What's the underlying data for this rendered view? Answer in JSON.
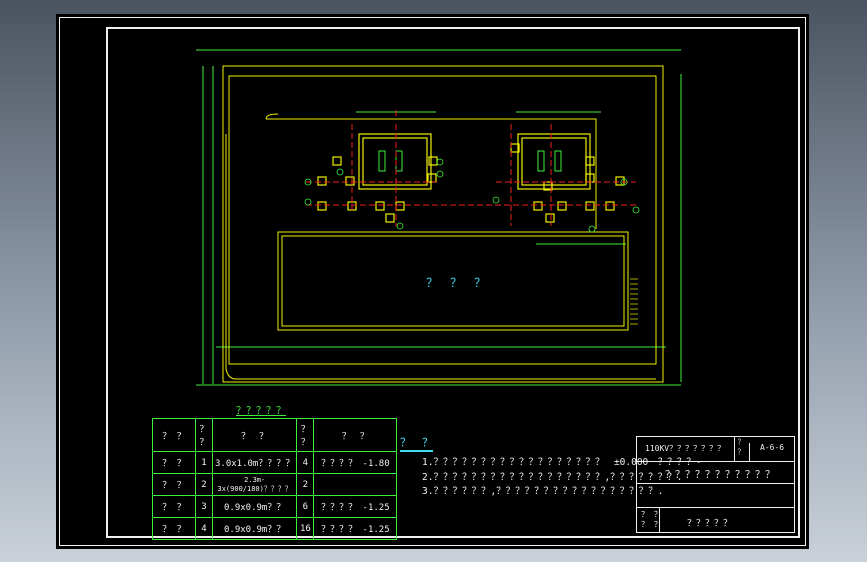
{
  "drawing": {
    "building_label": "？　？　？",
    "legend_title": "？？？？？",
    "notes_heading": "？　？",
    "notes": [
      "1.？？？？？？？？？？？？？？？？？？　±0.000　？？？？-",
      "2.？？？？？？？？？？？？？？？？？？,？？？？？？？.",
      "3.？？？？？？,？？？？？？？？？？？？？？？？？."
    ]
  },
  "legend": {
    "headers": [
      "？ ？",
      "？\n？",
      "？　？",
      "？\n？",
      "？　？"
    ],
    "rows": [
      {
        "no": "1",
        "spec": "3.0x1.0m？？？？",
        "qm": "？",
        "qty": "4",
        "elev": "？？？？",
        "elev_val": "-1.80"
      },
      {
        "no": "2",
        "spec": "2.3m-3x(900/180)？？？？",
        "qm": "？",
        "qty": "2",
        "elev": "",
        "elev_val": ""
      },
      {
        "no": "3",
        "spec": "0.9x0.9m？？",
        "qm": "？",
        "qty": "6",
        "elev": "？？？？",
        "elev_val": "-1.25"
      },
      {
        "no": "4",
        "spec": "0.9x0.9m？？",
        "qm": "？",
        "qty": "16",
        "elev": "？？？？",
        "elev_val": "-1.25"
      }
    ],
    "left_labels": [
      "？ ？",
      "？ ？",
      "？ ？",
      "？ ？"
    ]
  },
  "title_block": {
    "project": "110KV？？？？？？？",
    "qm_mark": "？\n？",
    "drawing_no": "A-6-6",
    "drawing_title": "？？？？？？？？？？？",
    "sheet_label": "？ ？\n？ ？",
    "sheet_value": "？？？？？"
  }
}
